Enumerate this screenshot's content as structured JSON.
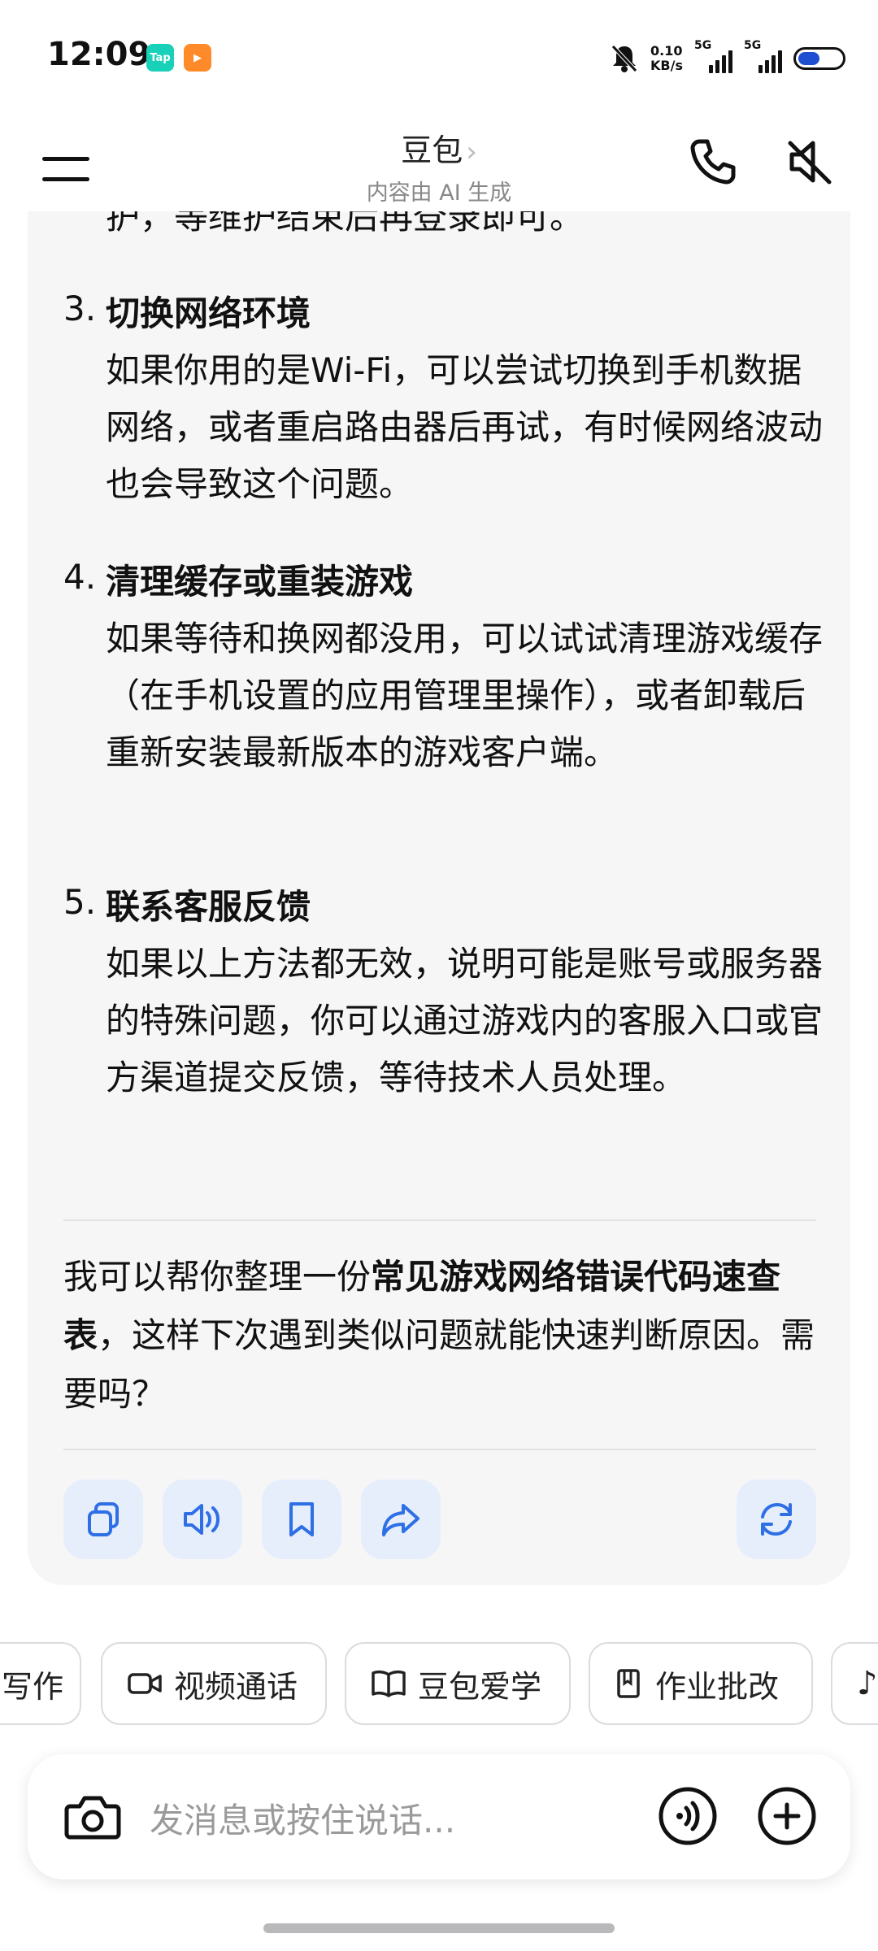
{
  "status_bar": {
    "time": "12:09",
    "app_badge_tap": "Tap",
    "app_badge_video": "▶",
    "net_speed_value": "0.10",
    "net_speed_unit": "KB/s",
    "signal1_label": "5G",
    "signal2_label": "5G"
  },
  "header": {
    "title": "豆包",
    "title_chevron": "›",
    "subtitle": "内容由 AI 生成"
  },
  "message": {
    "cut_line": "护，等维护结束后再登录即可。",
    "items": [
      {
        "num": "3.",
        "title": "切换网络环境",
        "body": "如果你用的是Wi-Fi，可以尝试切换到手机数据网络，或者重启路由器后再试，有时候网络波动也会导致这个问题。"
      },
      {
        "num": "4.",
        "title": "清理缓存或重装游戏",
        "body": "如果等待和换网都没用，可以试试清理游戏缓存（在手机设置的应用管理里操作），或者卸载后重新安装最新版本的游戏客户端。"
      },
      {
        "num": "5.",
        "title": "联系客服反馈",
        "body": "如果以上方法都无效，说明可能是账号或服务器的特殊问题，你可以通过游戏内的客服入口或官方渠道提交反馈，等待技术人员处理。"
      }
    ],
    "summary_pre": "我可以帮你整理一份",
    "summary_bold": "常见游戏网络错误代码速查表",
    "summary_post": "，这样下次遇到类似问题就能快速判断原因。需要吗？"
  },
  "chips": [
    {
      "label": "写作",
      "icon": "none"
    },
    {
      "label": "视频通话",
      "icon": "video-camera-icon"
    },
    {
      "label": "豆包爱学",
      "icon": "open-book-icon"
    },
    {
      "label": "作业批改",
      "icon": "homework-icon"
    }
  ],
  "composer": {
    "placeholder": "发消息或按住说话..."
  },
  "colors": {
    "accent": "#2f6fe6",
    "action_bg": "#e6eefc",
    "card_bg": "#f6f6f7"
  }
}
